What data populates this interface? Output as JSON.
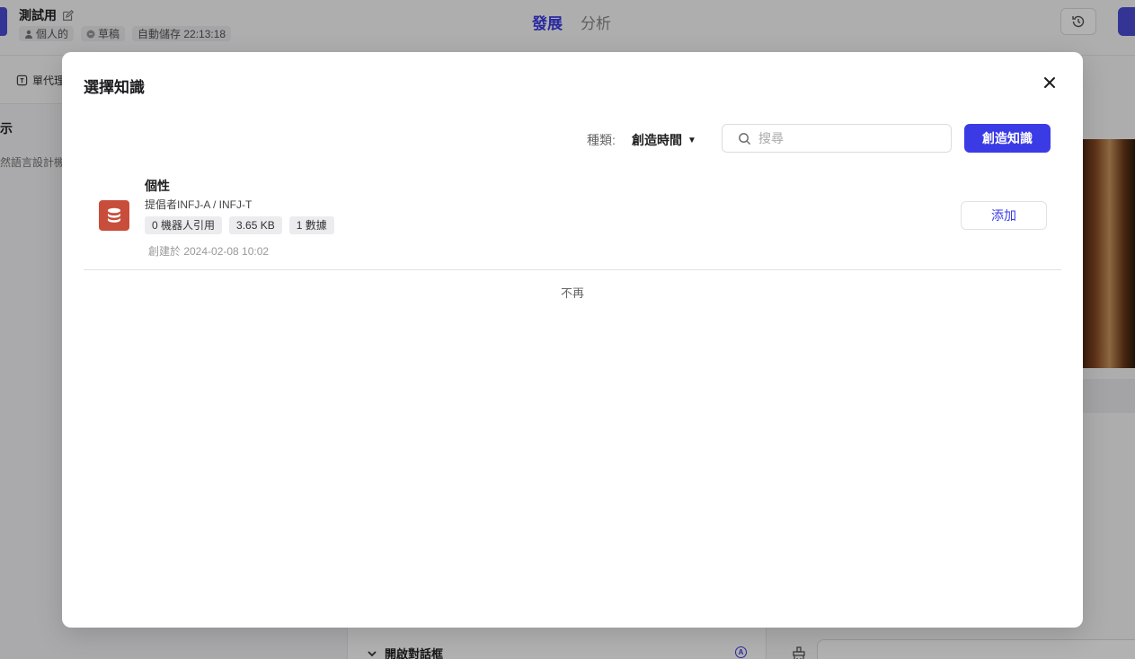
{
  "app": {
    "title": "測試用",
    "meta": {
      "visibility": "個人的",
      "status": "草稿",
      "autosave": "自動儲存 22:13:18"
    },
    "tabs": [
      {
        "label": "發展",
        "active": true
      },
      {
        "label": "分析",
        "active": false
      }
    ],
    "left_toolbar_item": "單代理",
    "left_heading": "示",
    "left_desc": "然語言設計機",
    "dialog_toggle_label": "開啟對話框",
    "dialog_badge": "A"
  },
  "modal": {
    "title": "選擇知識",
    "sort_label": "種類:",
    "sort_value": "創造時間",
    "search_placeholder": "搜尋",
    "create_label": "創造知識",
    "items": [
      {
        "name": "個性",
        "description": "提倡者INFJ-A / INFJ-T",
        "tags": [
          "0 機器人引用",
          "3.65 KB",
          "1 數據"
        ],
        "created": "創建於 2024-02-08 10:02",
        "add_label": "添加"
      }
    ],
    "end_text": "不再"
  },
  "colors": {
    "accent": "#3b3be6",
    "kb_icon_bg": "#c94d3b"
  }
}
